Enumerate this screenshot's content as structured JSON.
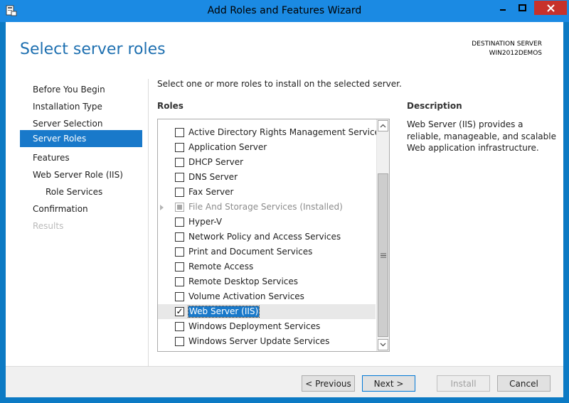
{
  "window": {
    "title": "Add Roles and Features Wizard"
  },
  "header": {
    "page_title": "Select server roles",
    "destination_label": "DESTINATION SERVER",
    "destination_name": "WIN2012DEMOS"
  },
  "nav": {
    "items": [
      {
        "label": "Before You Begin",
        "state": "normal"
      },
      {
        "label": "Installation Type",
        "state": "normal"
      },
      {
        "label": "Server Selection",
        "state": "normal"
      },
      {
        "label": "Server Roles",
        "state": "active"
      },
      {
        "label": "Features",
        "state": "normal"
      },
      {
        "label": "Web Server Role (IIS)",
        "state": "normal"
      },
      {
        "label": "Role Services",
        "state": "sub"
      },
      {
        "label": "Confirmation",
        "state": "normal"
      },
      {
        "label": "Results",
        "state": "disabled"
      }
    ]
  },
  "content": {
    "instruction": "Select one or more roles to install on the selected server.",
    "roles_label": "Roles",
    "roles": [
      {
        "label": "Active Directory Rights Management Services",
        "checked": false
      },
      {
        "label": "Application Server",
        "checked": false
      },
      {
        "label": "DHCP Server",
        "checked": false
      },
      {
        "label": "DNS Server",
        "checked": false
      },
      {
        "label": "Fax Server",
        "checked": false
      },
      {
        "label": "File And Storage Services (Installed)",
        "checked": false,
        "installed": true
      },
      {
        "label": "Hyper-V",
        "checked": false
      },
      {
        "label": "Network Policy and Access Services",
        "checked": false
      },
      {
        "label": "Print and Document Services",
        "checked": false
      },
      {
        "label": "Remote Access",
        "checked": false
      },
      {
        "label": "Remote Desktop Services",
        "checked": false
      },
      {
        "label": "Volume Activation Services",
        "checked": false
      },
      {
        "label": "Web Server (IIS)",
        "checked": true,
        "selected": true
      },
      {
        "label": "Windows Deployment Services",
        "checked": false
      },
      {
        "label": "Windows Server Update Services",
        "checked": false
      }
    ],
    "check_mark": "✓",
    "description_label": "Description",
    "description_text": "Web Server (IIS) provides a reliable, manageable, and scalable Web application infrastructure."
  },
  "footer": {
    "previous_label": "< Previous",
    "next_label": "Next >",
    "install_label": "Install",
    "cancel_label": "Cancel"
  },
  "colors": {
    "titlebar": "#1b8ae3",
    "accent": "#1979ca",
    "title_text": "#1d6fb0",
    "close_button": "#c7312b"
  }
}
